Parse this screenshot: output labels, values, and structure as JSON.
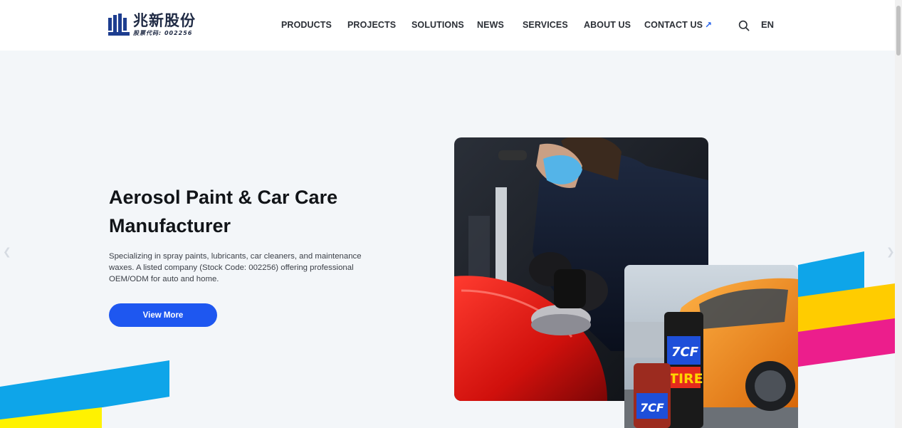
{
  "header": {
    "logo": {
      "cn_name": "兆新股份",
      "stock_code": "股票代码: 002256",
      "mark_color": "#1d3d8f"
    },
    "nav": [
      {
        "label": "PRODUCTS"
      },
      {
        "label": "PROJECTS"
      },
      {
        "label": "SOLUTIONS"
      },
      {
        "label": "NEWS"
      },
      {
        "label": "SERVICES"
      },
      {
        "label": "ABOUT US"
      },
      {
        "label": "CONTACT US",
        "arrow": "↗"
      }
    ],
    "search_icon": "search-icon",
    "language": "EN"
  },
  "hero": {
    "title_line1": "Aerosol Paint & Car Care",
    "title_line2": "Manufacturer",
    "description": "Specializing in spray paints, lubricants, car cleaners, and maintenance waxes. A listed company (Stock Code: 002256) offering professional OEM/ODM for auto and home.",
    "cta_label": "View More",
    "accent_color": "#1e57f0"
  },
  "images": {
    "main": "worker-polishing-red-car-photo",
    "secondary": "7cf-spray-cans-orange-car-photo",
    "can_brand": "7CF",
    "can_label": "TIRE"
  },
  "decor": {
    "stripe_colors": [
      "#0ea5e9",
      "#ffcc00",
      "#ec1e8c"
    ]
  },
  "slider": {
    "prev_icon": "chevron-left-icon",
    "next_icon": "chevron-right-icon"
  }
}
